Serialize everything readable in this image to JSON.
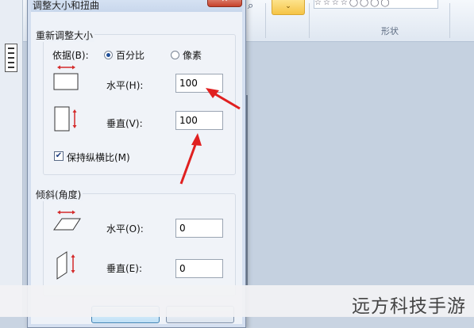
{
  "background": {
    "shapes_label": "形状",
    "color_dropdown_glyph": "⌄",
    "shapes_glyphs": "☆☆☆☆◯◯◯◯"
  },
  "dialog": {
    "title": "调整大小和扭曲",
    "close_glyph": "✕",
    "resize": {
      "group_title": "重新调整大小",
      "basis_label": "依据(B):",
      "option_percent": "百分比",
      "option_pixels": "像素",
      "selected": "percent",
      "horizontal_label": "水平(H):",
      "horizontal_value": "100",
      "vertical_label": "垂直(V):",
      "vertical_value": "100",
      "keep_ratio_label": "保持纵横比(M)",
      "keep_ratio_checked": true
    },
    "skew": {
      "group_title": "倾斜(角度)",
      "horizontal_label": "水平(O):",
      "horizontal_value": "0",
      "vertical_label": "垂直(E):",
      "vertical_value": "0"
    }
  },
  "colors": {
    "arrow_red": "#e02020",
    "icon_red": "#d42a2a"
  },
  "watermark": "远方科技手游"
}
